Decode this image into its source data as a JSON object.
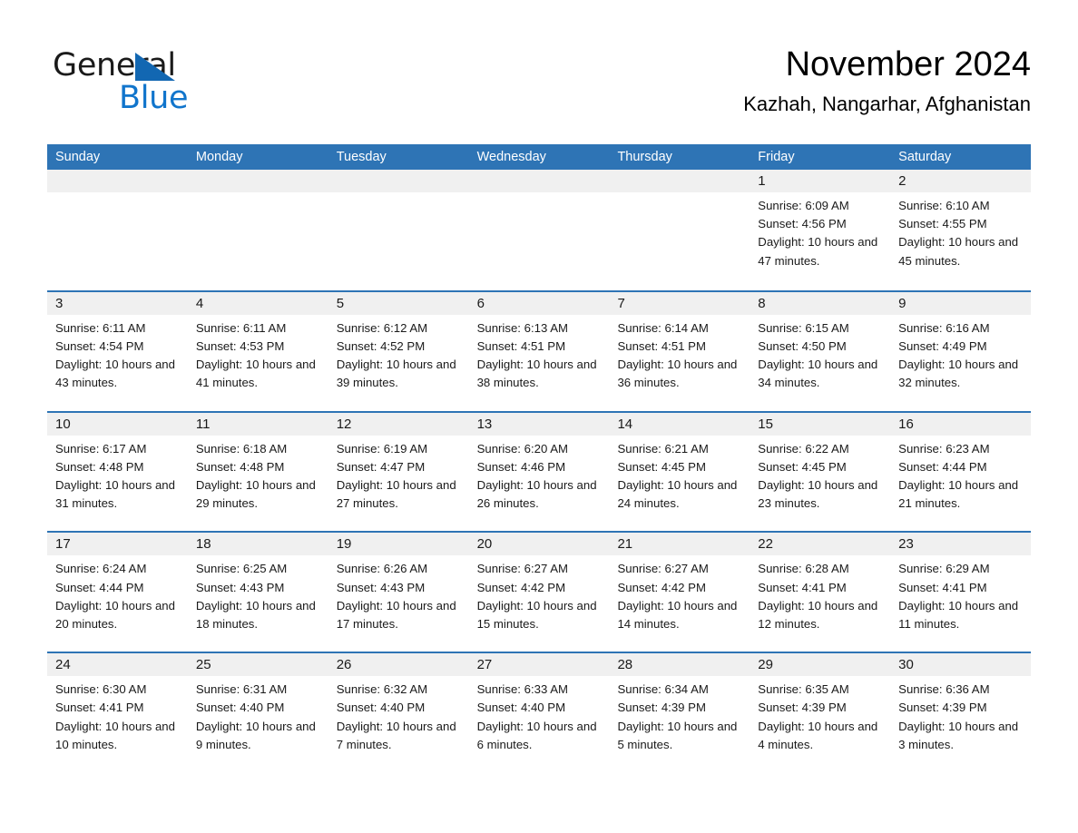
{
  "logo": {
    "text_primary": "General",
    "text_secondary": "Blue",
    "triangle_color": "#1267b2",
    "blue_color": "#1175cc"
  },
  "header": {
    "title": "November 2024",
    "subtitle": "Kazhah, Nangarhar, Afghanistan"
  },
  "theme": {
    "header_blue": "#2e74b5",
    "day_band_gray": "#f0f0f0",
    "separator_blue": "#2e74b5"
  },
  "weekdays": [
    "Sunday",
    "Monday",
    "Tuesday",
    "Wednesday",
    "Thursday",
    "Friday",
    "Saturday"
  ],
  "weeks": [
    [
      {
        "day": "",
        "sunrise": "",
        "sunset": "",
        "daylight": ""
      },
      {
        "day": "",
        "sunrise": "",
        "sunset": "",
        "daylight": ""
      },
      {
        "day": "",
        "sunrise": "",
        "sunset": "",
        "daylight": ""
      },
      {
        "day": "",
        "sunrise": "",
        "sunset": "",
        "daylight": ""
      },
      {
        "day": "",
        "sunrise": "",
        "sunset": "",
        "daylight": ""
      },
      {
        "day": "1",
        "sunrise": "Sunrise: 6:09 AM",
        "sunset": "Sunset: 4:56 PM",
        "daylight": "Daylight: 10 hours and 47 minutes."
      },
      {
        "day": "2",
        "sunrise": "Sunrise: 6:10 AM",
        "sunset": "Sunset: 4:55 PM",
        "daylight": "Daylight: 10 hours and 45 minutes."
      }
    ],
    [
      {
        "day": "3",
        "sunrise": "Sunrise: 6:11 AM",
        "sunset": "Sunset: 4:54 PM",
        "daylight": "Daylight: 10 hours and 43 minutes."
      },
      {
        "day": "4",
        "sunrise": "Sunrise: 6:11 AM",
        "sunset": "Sunset: 4:53 PM",
        "daylight": "Daylight: 10 hours and 41 minutes."
      },
      {
        "day": "5",
        "sunrise": "Sunrise: 6:12 AM",
        "sunset": "Sunset: 4:52 PM",
        "daylight": "Daylight: 10 hours and 39 minutes."
      },
      {
        "day": "6",
        "sunrise": "Sunrise: 6:13 AM",
        "sunset": "Sunset: 4:51 PM",
        "daylight": "Daylight: 10 hours and 38 minutes."
      },
      {
        "day": "7",
        "sunrise": "Sunrise: 6:14 AM",
        "sunset": "Sunset: 4:51 PM",
        "daylight": "Daylight: 10 hours and 36 minutes."
      },
      {
        "day": "8",
        "sunrise": "Sunrise: 6:15 AM",
        "sunset": "Sunset: 4:50 PM",
        "daylight": "Daylight: 10 hours and 34 minutes."
      },
      {
        "day": "9",
        "sunrise": "Sunrise: 6:16 AM",
        "sunset": "Sunset: 4:49 PM",
        "daylight": "Daylight: 10 hours and 32 minutes."
      }
    ],
    [
      {
        "day": "10",
        "sunrise": "Sunrise: 6:17 AM",
        "sunset": "Sunset: 4:48 PM",
        "daylight": "Daylight: 10 hours and 31 minutes."
      },
      {
        "day": "11",
        "sunrise": "Sunrise: 6:18 AM",
        "sunset": "Sunset: 4:48 PM",
        "daylight": "Daylight: 10 hours and 29 minutes."
      },
      {
        "day": "12",
        "sunrise": "Sunrise: 6:19 AM",
        "sunset": "Sunset: 4:47 PM",
        "daylight": "Daylight: 10 hours and 27 minutes."
      },
      {
        "day": "13",
        "sunrise": "Sunrise: 6:20 AM",
        "sunset": "Sunset: 4:46 PM",
        "daylight": "Daylight: 10 hours and 26 minutes."
      },
      {
        "day": "14",
        "sunrise": "Sunrise: 6:21 AM",
        "sunset": "Sunset: 4:45 PM",
        "daylight": "Daylight: 10 hours and 24 minutes."
      },
      {
        "day": "15",
        "sunrise": "Sunrise: 6:22 AM",
        "sunset": "Sunset: 4:45 PM",
        "daylight": "Daylight: 10 hours and 23 minutes."
      },
      {
        "day": "16",
        "sunrise": "Sunrise: 6:23 AM",
        "sunset": "Sunset: 4:44 PM",
        "daylight": "Daylight: 10 hours and 21 minutes."
      }
    ],
    [
      {
        "day": "17",
        "sunrise": "Sunrise: 6:24 AM",
        "sunset": "Sunset: 4:44 PM",
        "daylight": "Daylight: 10 hours and 20 minutes."
      },
      {
        "day": "18",
        "sunrise": "Sunrise: 6:25 AM",
        "sunset": "Sunset: 4:43 PM",
        "daylight": "Daylight: 10 hours and 18 minutes."
      },
      {
        "day": "19",
        "sunrise": "Sunrise: 6:26 AM",
        "sunset": "Sunset: 4:43 PM",
        "daylight": "Daylight: 10 hours and 17 minutes."
      },
      {
        "day": "20",
        "sunrise": "Sunrise: 6:27 AM",
        "sunset": "Sunset: 4:42 PM",
        "daylight": "Daylight: 10 hours and 15 minutes."
      },
      {
        "day": "21",
        "sunrise": "Sunrise: 6:27 AM",
        "sunset": "Sunset: 4:42 PM",
        "daylight": "Daylight: 10 hours and 14 minutes."
      },
      {
        "day": "22",
        "sunrise": "Sunrise: 6:28 AM",
        "sunset": "Sunset: 4:41 PM",
        "daylight": "Daylight: 10 hours and 12 minutes."
      },
      {
        "day": "23",
        "sunrise": "Sunrise: 6:29 AM",
        "sunset": "Sunset: 4:41 PM",
        "daylight": "Daylight: 10 hours and 11 minutes."
      }
    ],
    [
      {
        "day": "24",
        "sunrise": "Sunrise: 6:30 AM",
        "sunset": "Sunset: 4:41 PM",
        "daylight": "Daylight: 10 hours and 10 minutes."
      },
      {
        "day": "25",
        "sunrise": "Sunrise: 6:31 AM",
        "sunset": "Sunset: 4:40 PM",
        "daylight": "Daylight: 10 hours and 9 minutes."
      },
      {
        "day": "26",
        "sunrise": "Sunrise: 6:32 AM",
        "sunset": "Sunset: 4:40 PM",
        "daylight": "Daylight: 10 hours and 7 minutes."
      },
      {
        "day": "27",
        "sunrise": "Sunrise: 6:33 AM",
        "sunset": "Sunset: 4:40 PM",
        "daylight": "Daylight: 10 hours and 6 minutes."
      },
      {
        "day": "28",
        "sunrise": "Sunrise: 6:34 AM",
        "sunset": "Sunset: 4:39 PM",
        "daylight": "Daylight: 10 hours and 5 minutes."
      },
      {
        "day": "29",
        "sunrise": "Sunrise: 6:35 AM",
        "sunset": "Sunset: 4:39 PM",
        "daylight": "Daylight: 10 hours and 4 minutes."
      },
      {
        "day": "30",
        "sunrise": "Sunrise: 6:36 AM",
        "sunset": "Sunset: 4:39 PM",
        "daylight": "Daylight: 10 hours and 3 minutes."
      }
    ]
  ]
}
